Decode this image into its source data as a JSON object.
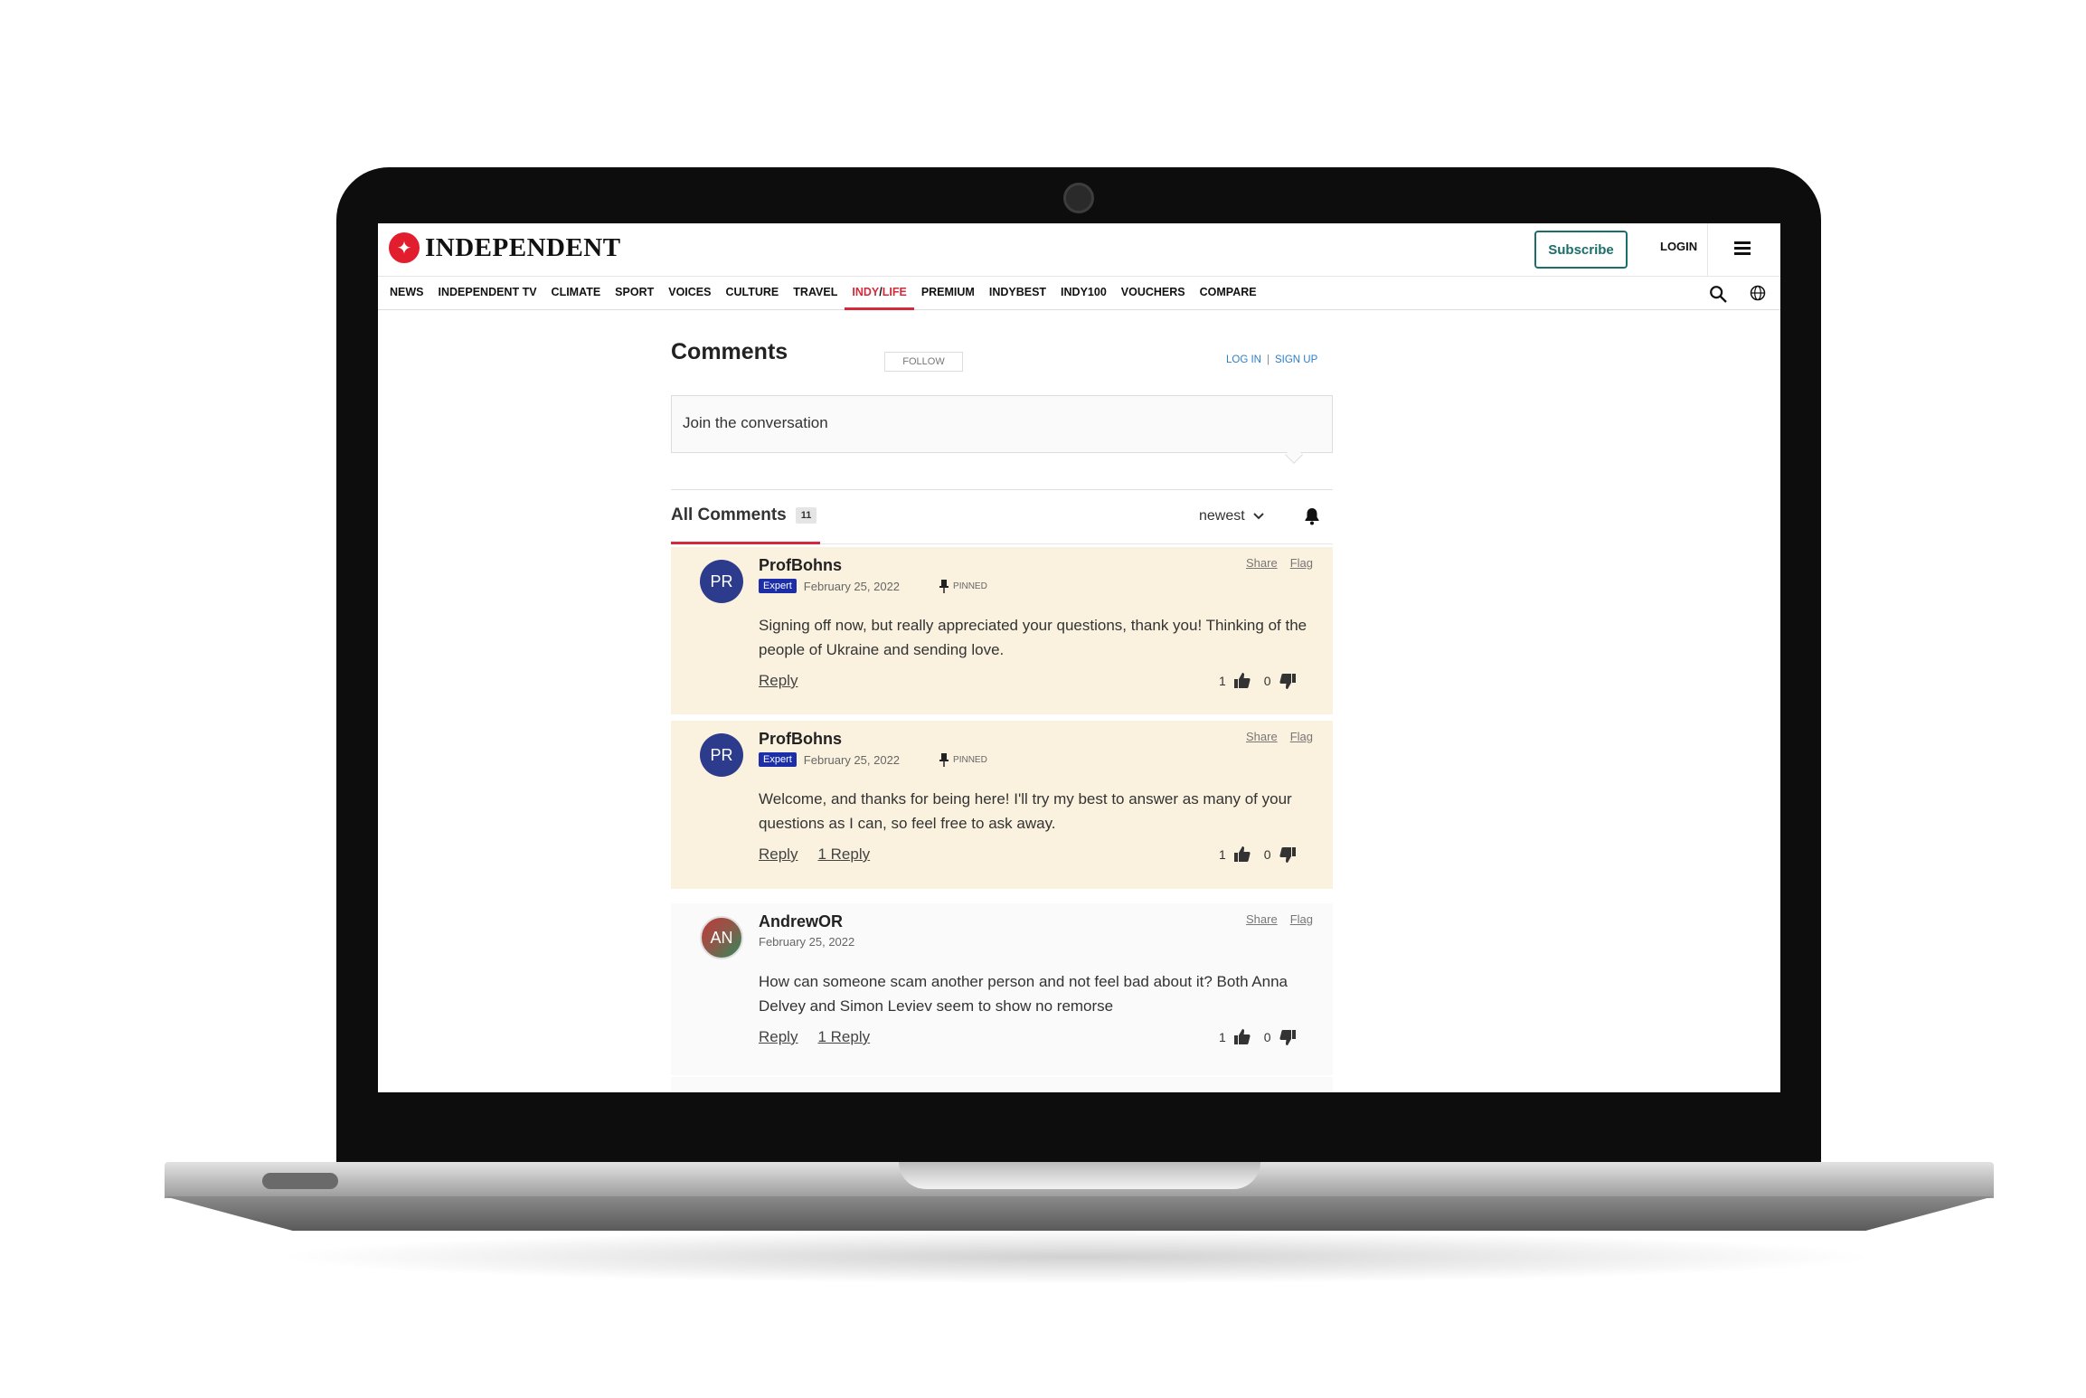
{
  "site": {
    "logo_text": "INDEPENDENT",
    "subscribe_label": "Subscribe",
    "login_label": "LOGIN",
    "brand_red": "#d42a3c",
    "accent_teal": "#1b6e6a"
  },
  "nav": {
    "items": [
      "NEWS",
      "INDEPENDENT TV",
      "CLIMATE",
      "SPORT",
      "VOICES",
      "CULTURE",
      "TRAVEL",
      "INDY/LIFE",
      "PREMIUM",
      "INDYBEST",
      "INDY100",
      "VOUCHERS",
      "COMPARE"
    ],
    "active": "INDY/LIFE",
    "active_prefix": "INDY",
    "active_suffix": "LIFE"
  },
  "comments": {
    "title": "Comments",
    "follow_label": "FOLLOW",
    "login_label": "LOG IN",
    "signup_label": "SIGN UP",
    "join_placeholder": "Join the conversation",
    "all_label": "All Comments",
    "count": "11",
    "sort_label": "newest",
    "items": [
      {
        "initials": "PR",
        "author": "ProfBohns",
        "badge": "Expert",
        "date": "February 25, 2022",
        "pinned_label": "PINNED",
        "text": "Signing off now, but really appreciated your questions, thank you! Thinking of the people of Ukraine and sending love.",
        "reply_label": "Reply",
        "replies_label": "",
        "likes": "1",
        "dislikes": "0",
        "share_label": "Share",
        "flag_label": "Flag"
      },
      {
        "initials": "PR",
        "author": "ProfBohns",
        "badge": "Expert",
        "date": "February 25, 2022",
        "pinned_label": "PINNED",
        "text": "Welcome, and thanks for being here! I'll try my best to answer as many of your questions as I can, so feel free to ask away.",
        "reply_label": "Reply",
        "replies_label": "1 Reply",
        "likes": "1",
        "dislikes": "0",
        "share_label": "Share",
        "flag_label": "Flag"
      },
      {
        "initials": "AN",
        "author": "AndrewOR",
        "date": "February 25, 2022",
        "text": "How can someone scam another person and not feel bad about it? Both Anna Delvey and Simon Leviev seem to show no remorse",
        "reply_label": "Reply",
        "replies_label": "1 Reply",
        "likes": "1",
        "dislikes": "0",
        "share_label": "Share",
        "flag_label": "Flag"
      }
    ]
  }
}
